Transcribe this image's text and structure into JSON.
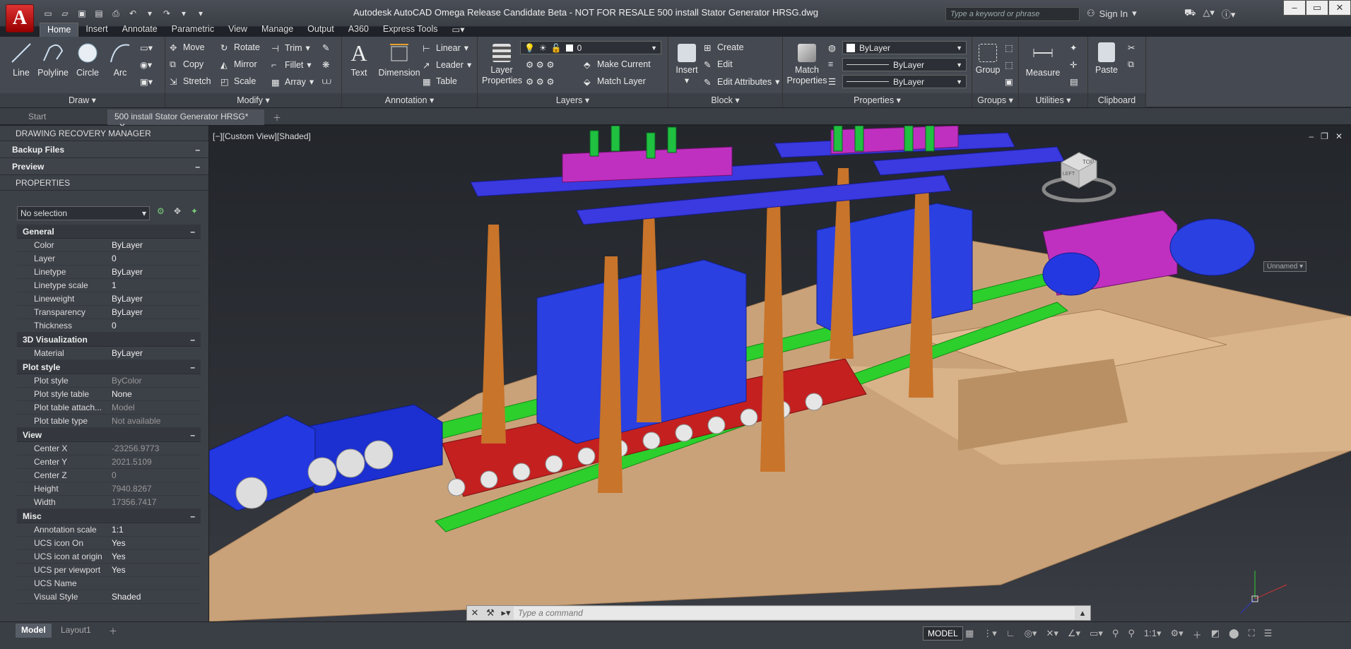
{
  "app": {
    "logo": "A",
    "title": "Autodesk AutoCAD Omega Release Candidate Beta - NOT FOR RESALE     500 install Stator Generator HRSG.dwg"
  },
  "search": {
    "placeholder": "Type a keyword or phrase"
  },
  "signin": {
    "label": "Sign In"
  },
  "ribbon_tabs": [
    "Home",
    "Insert",
    "Annotate",
    "Parametric",
    "View",
    "Manage",
    "Output",
    "A360",
    "Express Tools"
  ],
  "panels": {
    "draw": {
      "label": "Draw",
      "line": "Line",
      "polyline": "Polyline",
      "circle": "Circle",
      "arc": "Arc"
    },
    "modify": {
      "label": "Modify",
      "move": "Move",
      "rotate": "Rotate",
      "trim": "Trim",
      "copy": "Copy",
      "mirror": "Mirror",
      "fillet": "Fillet",
      "stretch": "Stretch",
      "scale": "Scale",
      "array": "Array"
    },
    "annotation": {
      "label": "Annotation",
      "text": "Text",
      "dimension": "Dimension",
      "linear": "Linear",
      "leader": "Leader",
      "table": "Table"
    },
    "layers": {
      "label": "Layers",
      "layer_properties": "Layer Properties",
      "layer_value": "0",
      "make_current": "Make Current",
      "match_layer": "Match Layer"
    },
    "block": {
      "label": "Block",
      "insert": "Insert",
      "create": "Create",
      "edit": "Edit",
      "edit_attributes": "Edit Attributes"
    },
    "properties": {
      "label": "Properties",
      "match_properties": "Match Properties",
      "color": "ByLayer",
      "linetype": "ByLayer",
      "lineweight": "ByLayer"
    },
    "groups": {
      "label": "Groups",
      "group": "Group"
    },
    "utilities": {
      "label": "Utilities",
      "measure": "Measure"
    },
    "clipboard": {
      "label": "Clipboard",
      "paste": "Paste"
    }
  },
  "doc_tabs": [
    "Start",
    "500 install Stator Generator HRSG*"
  ],
  "palette": {
    "title": "DRAWING RECOVERY MANAGER",
    "sections": [
      "Backup Files",
      "Preview"
    ],
    "properties_title": "PROPERTIES",
    "selection": "No selection",
    "general": {
      "title": "General",
      "rows": [
        [
          "Color",
          "ByLayer"
        ],
        [
          "Layer",
          "0"
        ],
        [
          "Linetype",
          "ByLayer"
        ],
        [
          "Linetype scale",
          "1"
        ],
        [
          "Lineweight",
          "ByLayer"
        ],
        [
          "Transparency",
          "ByLayer"
        ],
        [
          "Thickness",
          "0"
        ]
      ]
    },
    "visual3d": {
      "title": "3D Visualization",
      "rows": [
        [
          "Material",
          "ByLayer"
        ]
      ]
    },
    "plotstyle": {
      "title": "Plot style",
      "rows": [
        [
          "Plot style",
          "ByColor"
        ],
        [
          "Plot style table",
          "None"
        ],
        [
          "Plot table attach...",
          "Model"
        ],
        [
          "Plot table type",
          "Not available"
        ]
      ]
    },
    "view": {
      "title": "View",
      "rows": [
        [
          "Center X",
          "-23256.9773"
        ],
        [
          "Center Y",
          "2021.5109"
        ],
        [
          "Center Z",
          "0"
        ],
        [
          "Height",
          "7940.8267"
        ],
        [
          "Width",
          "17356.7417"
        ]
      ]
    },
    "misc": {
      "title": "Misc",
      "rows": [
        [
          "Annotation scale",
          "1:1"
        ],
        [
          "UCS icon On",
          "Yes"
        ],
        [
          "UCS icon at origin",
          "Yes"
        ],
        [
          "UCS per viewport",
          "Yes"
        ],
        [
          "UCS Name",
          ""
        ],
        [
          "Visual Style",
          "Shaded"
        ]
      ]
    }
  },
  "viewport": {
    "label": "[−][Custom View][Shaded]",
    "viewcube": {
      "top": "TOP",
      "left": "LEFT",
      "named": "Unnamed"
    }
  },
  "command": {
    "placeholder": "Type a command"
  },
  "layout_tabs": [
    "Model",
    "Layout1"
  ],
  "status": {
    "model": "MODEL",
    "scale": "1:1"
  },
  "colors": {
    "truck": "#1c2fd0",
    "trailer": "#c42020",
    "rails": "#2ccf2c",
    "columns": "#c8742a",
    "beams": "#3a3ae0",
    "header": "#c030c0",
    "ground": "#c9a27a",
    "stator": "#2a40e0"
  }
}
